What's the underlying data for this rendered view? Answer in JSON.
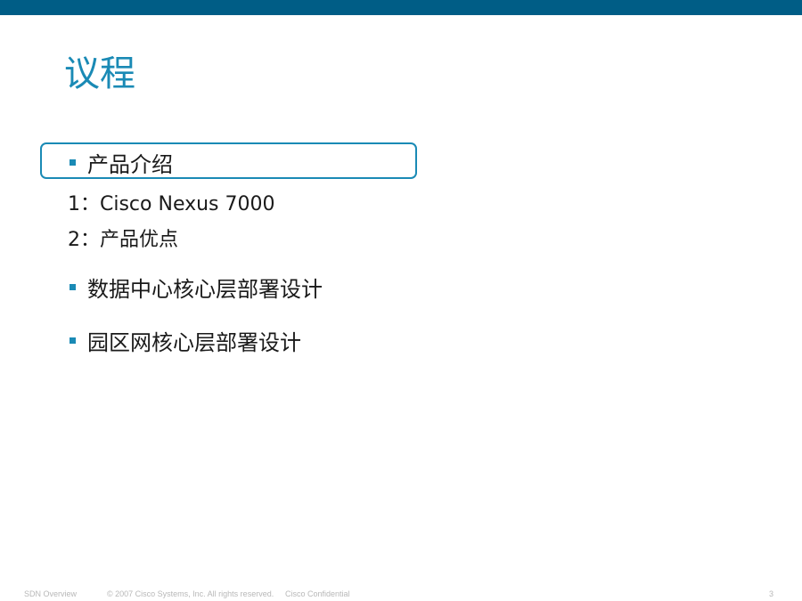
{
  "slide": {
    "title": "议程",
    "items": [
      {
        "text": "产品介绍",
        "highlighted": true
      },
      {
        "text": "1：Cisco Nexus 7000"
      },
      {
        "text": "2：产品优点"
      },
      {
        "text": "数据中心核心层部署设计"
      },
      {
        "text": "园区网核心层部署设计"
      }
    ]
  },
  "footer": {
    "presentation": "SDN Overview",
    "copyright": "© 2007 Cisco Systems, Inc. All rights reserved.",
    "confidential": "Cisco Confidential",
    "page_number": "3"
  },
  "colors": {
    "header_bar": "#005d86",
    "accent": "#1a8ab5"
  }
}
